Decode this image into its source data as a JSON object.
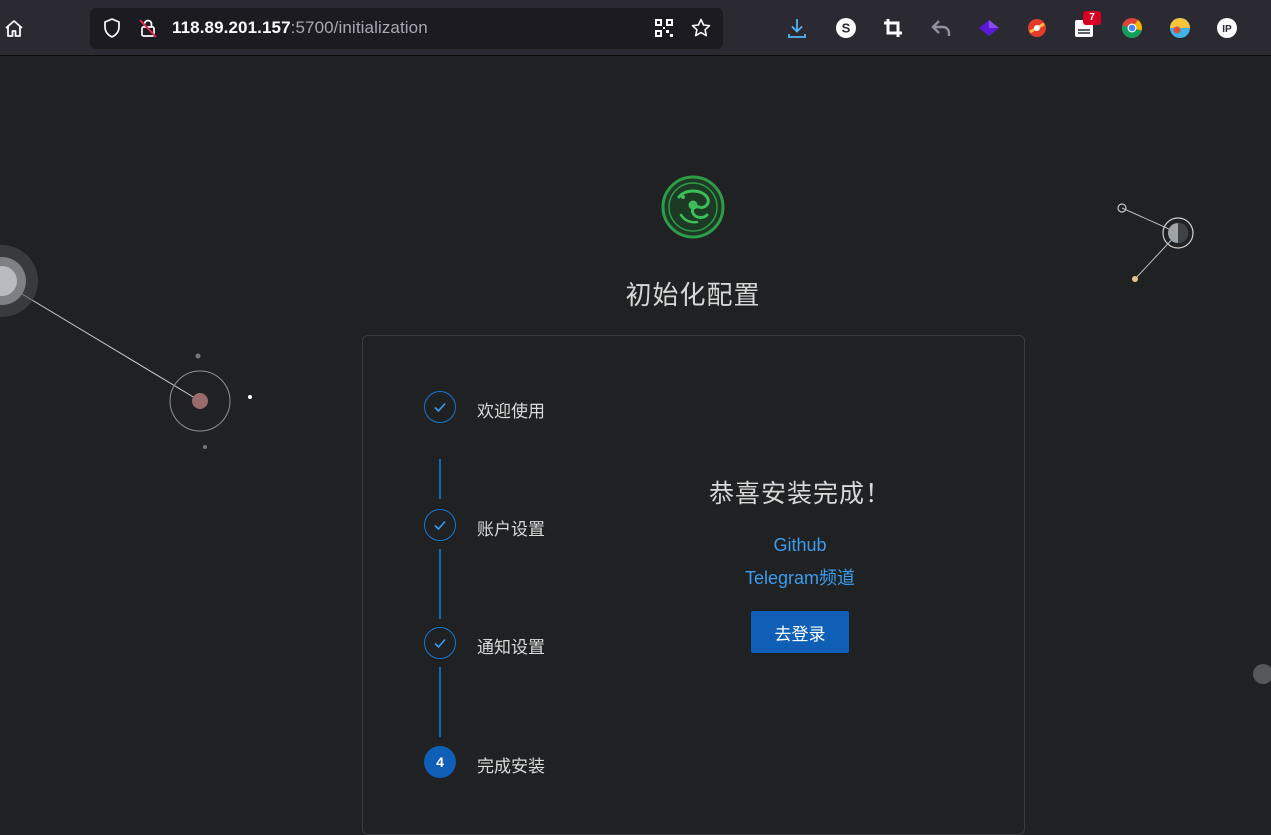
{
  "browser": {
    "url_host": "118.89.201.157",
    "url_rest": ":5700/initialization",
    "extension_badge": "7",
    "icons": [
      "home-icon",
      "shield-icon",
      "insecure-lock-icon",
      "qr-code-icon",
      "bookmark-star-icon",
      "download-icon",
      "s-extension-icon",
      "crop-icon",
      "undo-icon",
      "purple-extension-icon",
      "red-extension-icon",
      "mail-extension-icon",
      "chrome-icon",
      "colorful-extension-icon",
      "ip-extension-icon"
    ]
  },
  "page": {
    "title": "初始化配置",
    "steps": [
      {
        "label": "欢迎使用",
        "status": "done"
      },
      {
        "label": "账户设置",
        "status": "done"
      },
      {
        "label": "通知设置",
        "status": "done"
      },
      {
        "label": "完成安装",
        "status": "current",
        "number": "4"
      }
    ],
    "success_message": "恭喜安装完成！",
    "links": {
      "github": "Github",
      "telegram": "Telegram频道"
    },
    "login_button": "去登录"
  },
  "colors": {
    "background": "#1f2122",
    "accent": "#0e5fb5",
    "link": "#3b9cf0",
    "logo": "#2e9b48"
  }
}
